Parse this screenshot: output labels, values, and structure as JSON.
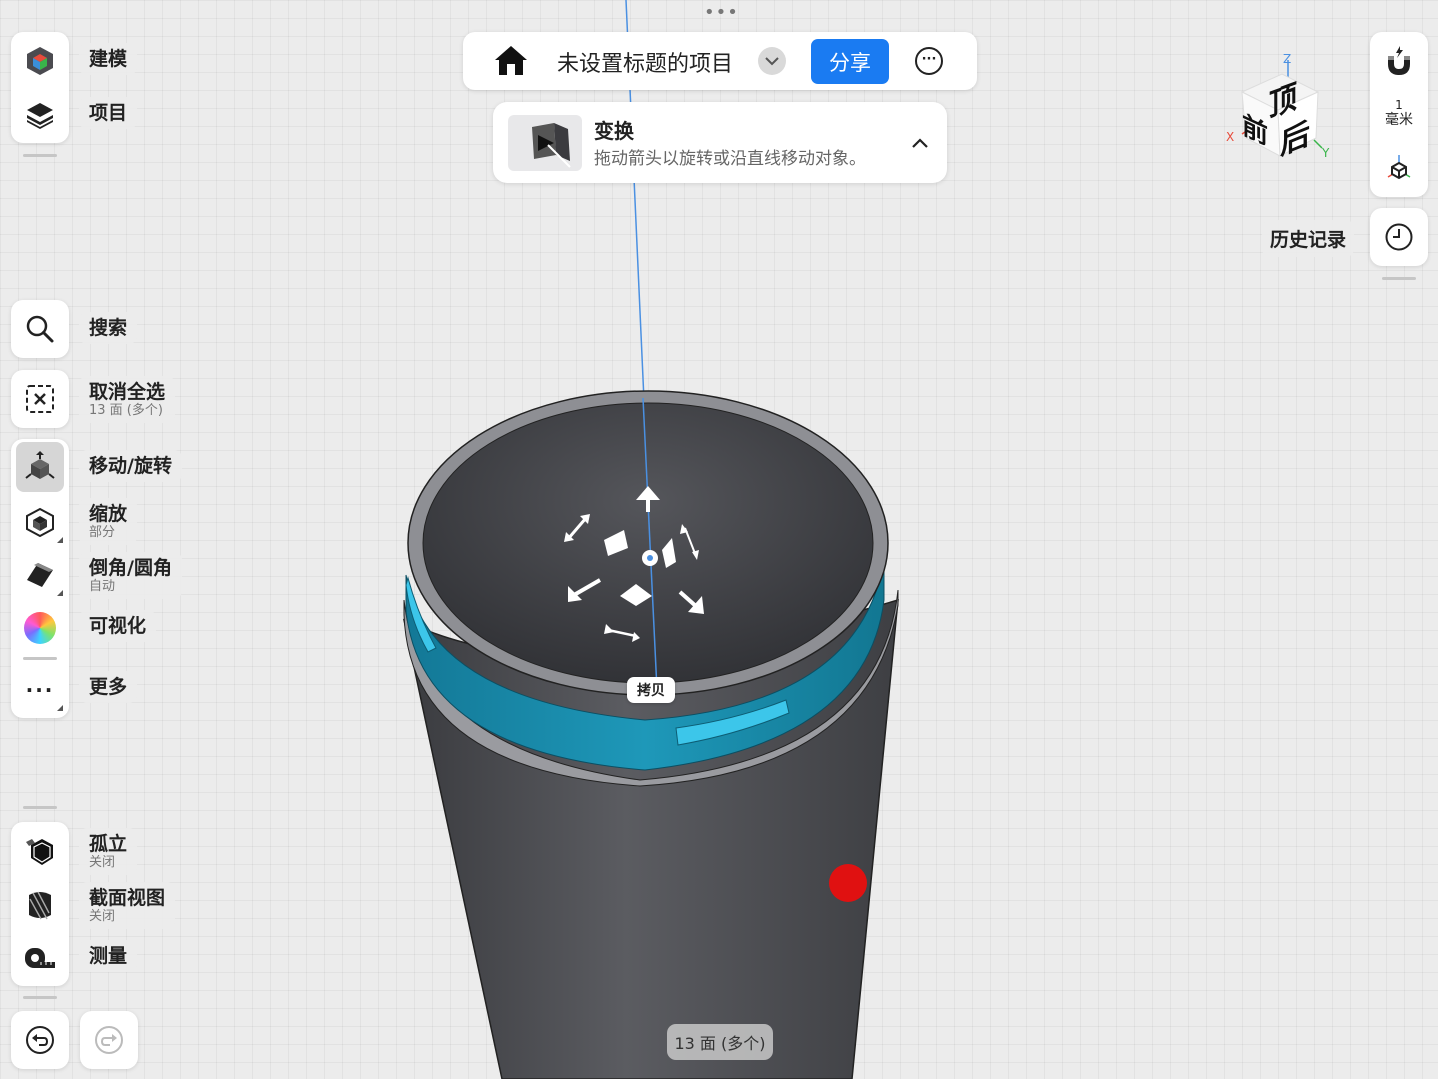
{
  "header": {
    "title": "未设置标题的项目",
    "share_label": "分享"
  },
  "transform_hint": {
    "title": "变换",
    "description": "拖动箭头以旋转或沿直线移动对象。"
  },
  "sidebar": {
    "top": [
      {
        "label": "建模",
        "icon": "modeling-cube-icon"
      },
      {
        "label": "项目",
        "icon": "layers-icon"
      }
    ],
    "tools": [
      {
        "label": "搜索",
        "sub": "",
        "icon": "search-icon"
      },
      {
        "label": "取消全选",
        "sub": "13 面 (多个)",
        "icon": "deselect-icon"
      },
      {
        "label": "移动/旋转",
        "sub": "",
        "icon": "move-rotate-icon"
      },
      {
        "label": "缩放",
        "sub": "部分",
        "icon": "scale-icon"
      },
      {
        "label": "倒角/圆角",
        "sub": "自动",
        "icon": "chamfer-fillet-icon"
      },
      {
        "label": "可视化",
        "sub": "",
        "icon": "color-wheel-icon"
      },
      {
        "label": "更多",
        "sub": "",
        "icon": "more-dots-icon"
      }
    ],
    "bottom": [
      {
        "label": "孤立",
        "sub": "关闭",
        "icon": "isolate-hexagon-icon"
      },
      {
        "label": "截面视图",
        "sub": "关闭",
        "icon": "section-view-icon"
      },
      {
        "label": "测量",
        "sub": "",
        "icon": "measure-tape-icon"
      }
    ]
  },
  "right_panel": {
    "grid_value": "1",
    "grid_unit": "毫米",
    "history_label": "历史记录"
  },
  "view_cube": {
    "face_top": "顶",
    "face_front": "前",
    "face_right": "后",
    "axis_x": "X",
    "axis_y": "Y",
    "axis_z": "Z"
  },
  "viewport": {
    "copy_label": "拷贝",
    "selection_status": "13 面 (多个)"
  },
  "colors": {
    "accent": "#1a7bf2",
    "selection": "#1f93b3",
    "model": "#56575c",
    "marker": "#e01111",
    "axis_line": "#4a90e2"
  }
}
